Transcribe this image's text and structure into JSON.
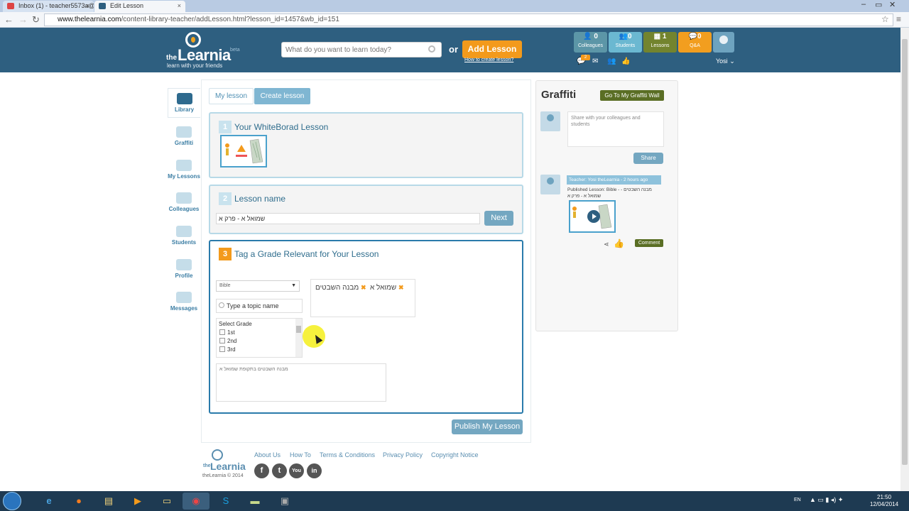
{
  "browser": {
    "tabs": [
      {
        "label": "Inbox (1) - teacher5573a@"
      },
      {
        "label": "Edit Lesson"
      }
    ],
    "url_host": "www.thelearnia.com",
    "url_path": "/content-library-teacher/addLesson.html?lesson_id=1457&wb_id=151"
  },
  "header": {
    "logo_the": "the",
    "logo_name": "Learnia",
    "logo_beta": "beta",
    "logo_tagline": "learn with your friends",
    "search_placeholder": "What do you want to learn today?",
    "or_label": "or",
    "add_lesson_label": "Add Lesson",
    "how_to_label": "How to create lesson?",
    "stats": [
      {
        "count": "0",
        "label": "Colleagues"
      },
      {
        "count": "0",
        "label": "Students"
      },
      {
        "count": "1",
        "label": "Lessons"
      },
      {
        "count": "0",
        "label": "Q&A"
      }
    ],
    "notif_count": "2",
    "username": "Yosi"
  },
  "sidebar": {
    "items": [
      {
        "label": "Library",
        "icon": "library-icon"
      },
      {
        "label": "Graffiti",
        "icon": "graffiti-icon"
      },
      {
        "label": "My Lessons",
        "icon": "my-lessons-icon"
      },
      {
        "label": "Colleagues",
        "icon": "colleagues-icon"
      },
      {
        "label": "Students",
        "icon": "students-icon"
      },
      {
        "label": "Profile",
        "icon": "profile-icon"
      },
      {
        "label": "Messages",
        "icon": "messages-icon"
      }
    ]
  },
  "main": {
    "tabs": [
      {
        "label": "My lesson"
      },
      {
        "label": "Create lesson"
      }
    ],
    "step1": {
      "num": "1",
      "title": "Your WhiteBorad Lesson"
    },
    "step2": {
      "num": "2",
      "title": "Lesson name",
      "value": "שמואל א - פרק א",
      "next_label": "Next"
    },
    "step3": {
      "num": "3",
      "title": "Tag a Grade Relevant for Your Lesson",
      "subject_value": "Bible",
      "topic_placeholder": "Type a topic name",
      "tags": [
        "שמואל א",
        "מבנה השבטים"
      ],
      "grade_header": "Select Grade",
      "grades": [
        "1st",
        "2nd",
        "3rd"
      ],
      "description": "מבנה השבטים בתקופת שמואל א"
    },
    "publish_label": "Publish My Lesson"
  },
  "graffiti": {
    "title": "Graffiti",
    "wall_button": "Go To My Graffiti Wall",
    "share_placeholder": "Share with your colleagues and students",
    "share_button": "Share",
    "post_header": "Teacher: Yosi theLearnia - 2 hours ago",
    "post_body": "Published Lesson: Bible - מבנה השבטים - שמואל א - פרק א",
    "comment_button": "Comment"
  },
  "footer": {
    "logo_the": "the",
    "logo_name": "Learnia",
    "copyright": "theLearnia © 2014",
    "links": [
      "About Us",
      "How To",
      "Terms & Conditions",
      "Privacy Policy",
      "Copyright Notice"
    ],
    "social": [
      "f",
      "t",
      "You",
      "in"
    ]
  },
  "taskbar": {
    "lang": "EN",
    "time": "21:50",
    "date": "12/04/2014"
  },
  "colors": {
    "header_bg": "#2e5f80",
    "accent_orange": "#f39a1c",
    "accent_blue": "#74a7c1",
    "olive": "#5a6e24"
  }
}
